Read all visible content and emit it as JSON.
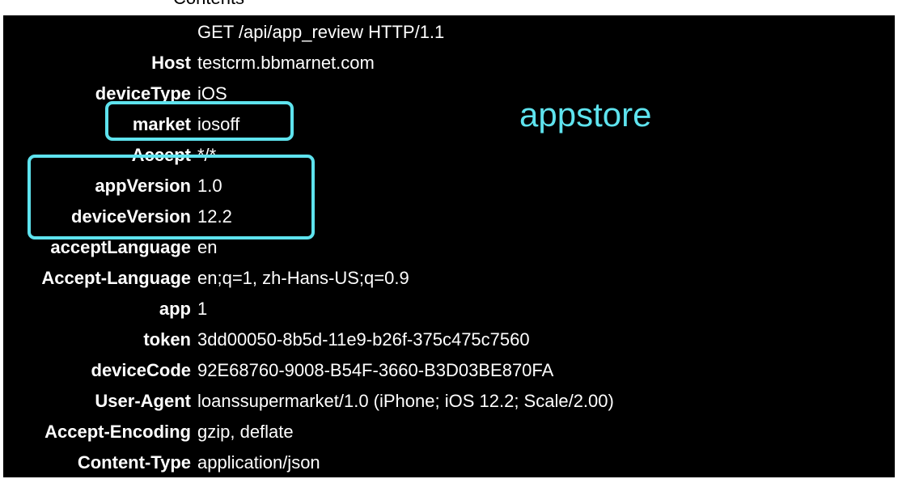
{
  "section_title": "Contents",
  "request_line": "GET /api/app_review HTTP/1.1",
  "headers": [
    {
      "key": "Host",
      "value": "testcrm.bbmarnet.com"
    },
    {
      "key": "deviceType",
      "value": "iOS"
    },
    {
      "key": "market",
      "value": "iosoff"
    },
    {
      "key": "Accept",
      "value": "*/*"
    },
    {
      "key": "appVersion",
      "value": "1.0"
    },
    {
      "key": "deviceVersion",
      "value": "12.2"
    },
    {
      "key": "acceptLanguage",
      "value": "en"
    },
    {
      "key": "Accept-Language",
      "value": "en;q=1, zh-Hans-US;q=0.9"
    },
    {
      "key": "app",
      "value": "1"
    },
    {
      "key": "token",
      "value": "3dd00050-8b5d-11e9-b26f-375c475c7560"
    },
    {
      "key": "deviceCode",
      "value": "92E68760-9008-B54F-3660-B3D03BE870FA"
    },
    {
      "key": "User-Agent",
      "value": "loanssupermarket/1.0 (iPhone; iOS 12.2; Scale/2.00)"
    },
    {
      "key": "Accept-Encoding",
      "value": "gzip, deflate"
    },
    {
      "key": "Content-Type",
      "value": "application/json"
    }
  ],
  "annotation": {
    "text": "appstore",
    "color": "#5ee3ee"
  },
  "colors": {
    "panel_background": "#000000",
    "text": "#ffffff",
    "highlight": "#5ee3ee"
  }
}
